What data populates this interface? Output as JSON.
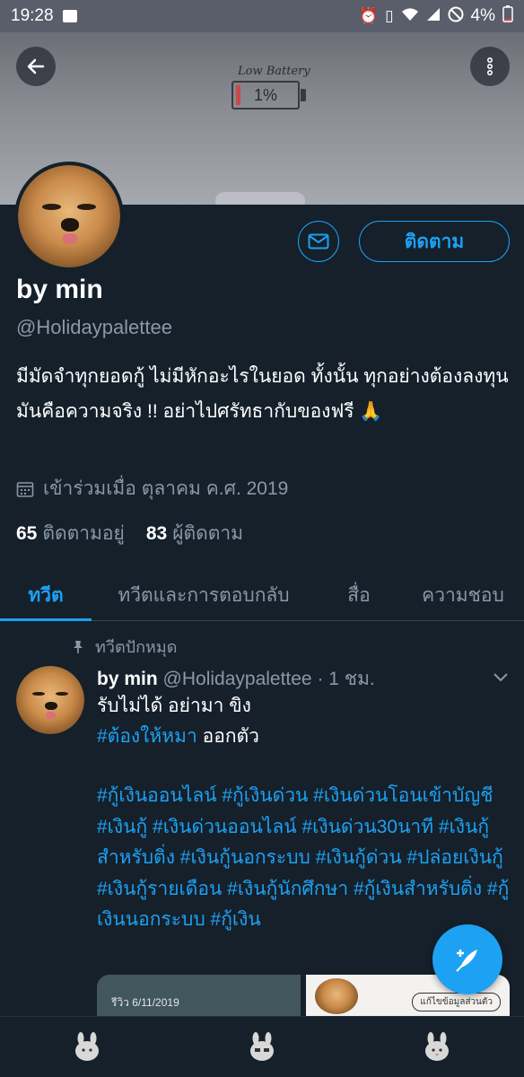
{
  "status_bar": {
    "time": "19:28",
    "battery": "4%",
    "icons": [
      "gallery-icon",
      "alarm-icon",
      "vibrate-icon",
      "wifi-icon",
      "signal-icon",
      "dnd-icon",
      "battery-icon"
    ]
  },
  "banner": {
    "label": "Low Battery",
    "level_text": "1%"
  },
  "profile": {
    "name": "by min",
    "handle": "@Holidaypalettee",
    "follow_label": "ติดตาม",
    "bio": "มีมัดจำทุกยอดกู้ ไม่มีหักอะไรในยอด ทั้งนั้น ทุกอย่างต้องลงทุน มันคือความจริง !! อย่าไปศรัทธากับของฟรี 🙏",
    "joined": "เข้าร่วมเมื่อ ตุลาคม ค.ศ. 2019",
    "following_count": "65",
    "following_label": "ติดตามอยู่",
    "followers_count": "83",
    "followers_label": "ผู้ติดตาม"
  },
  "tabs": [
    {
      "label": "ทวีต",
      "active": true
    },
    {
      "label": "ทวีตและการตอบกลับ",
      "active": false
    },
    {
      "label": "สื่อ",
      "active": false
    },
    {
      "label": "ความชอบ",
      "active": false
    }
  ],
  "tweet": {
    "pinned_label": "ทวีตปักหมุด",
    "author": "by min",
    "handle": "@Holidaypalettee",
    "time": "· 1 ชม.",
    "line1": "รับไม่ได้ อย่ามา ขิง",
    "line2_tag": "#ต้องให้หมา",
    "line2_rest": " ออกตัว",
    "hashtags": "#กู้เงินออนไลน์ #กู้เงินด่วน #เงินด่วนโอนเข้าบัญชี #เงินกู้ #เงินด่วนออนไลน์ #เงินด่วน30นาที #เงินกู้สำหรับติ่ง #เงินกู้นอกระบบ #เงินกู้ด่วน  #ปล่อยเงินกู้  #เงินกู้รายเดือน #เงินกู้นักศึกษา #กู้เงินสำหรับติ่ง #กู้เงินนอกระบบ #กู้เงิน",
    "media1_text": "รีวิว 6/11/2019",
    "media2_text": "แก้ไขข้อมูลส่วนตัว"
  },
  "colors": {
    "background": "#15202b",
    "accent": "#1da1f2",
    "secondary_text": "#8899a6"
  }
}
